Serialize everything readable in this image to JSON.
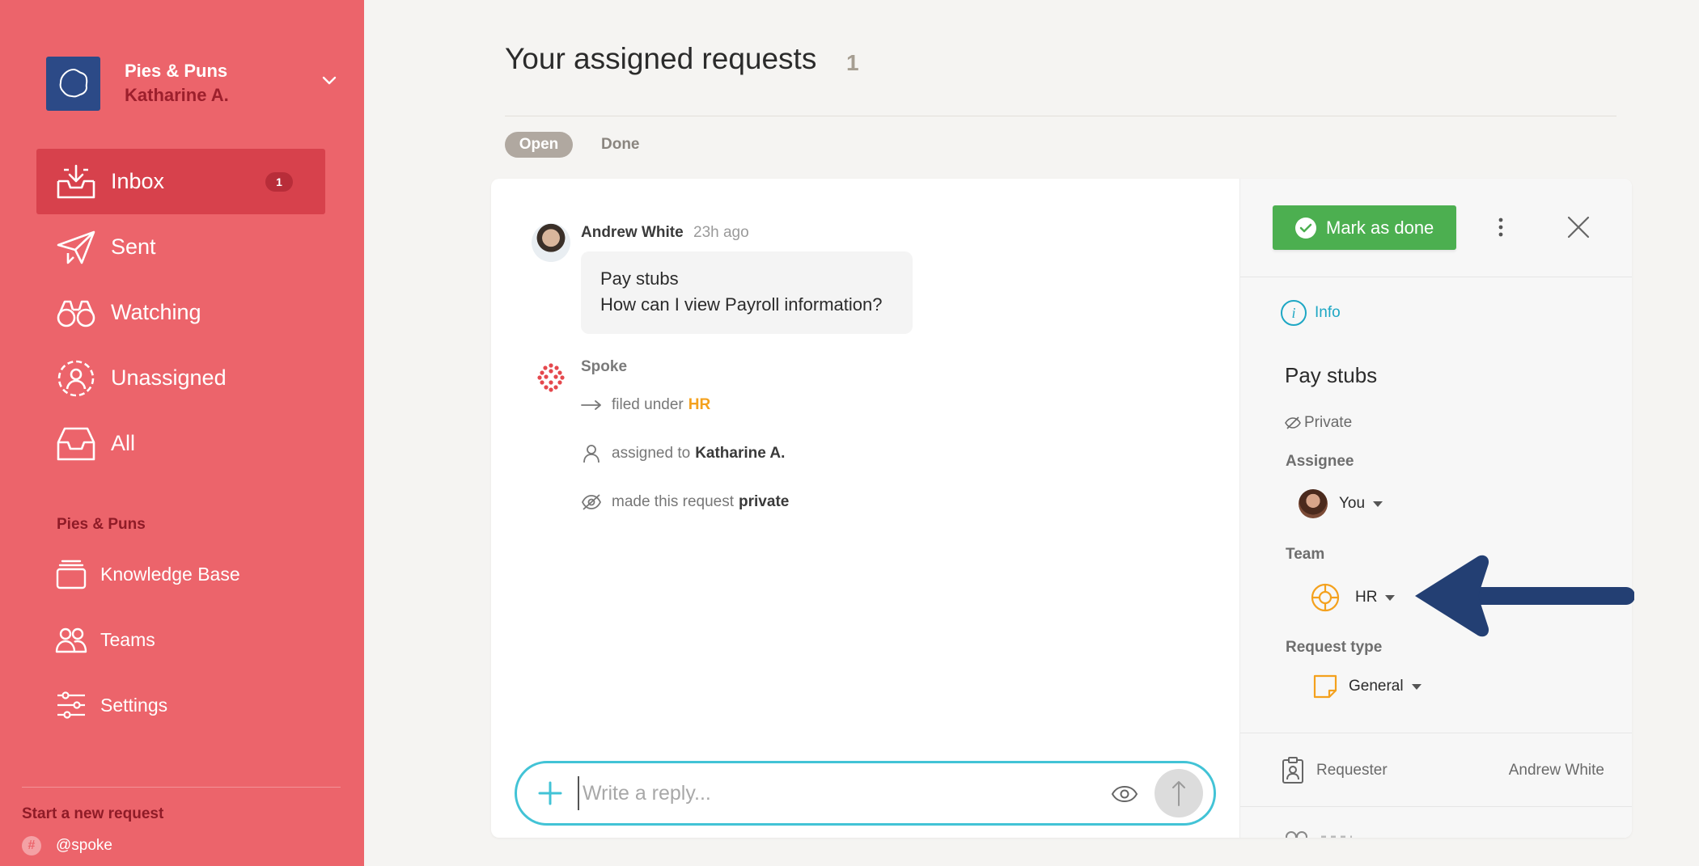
{
  "workspace": {
    "name": "Pies & Puns",
    "user": "Katharine A."
  },
  "nav": {
    "items": [
      {
        "label": "Inbox",
        "badge": "1",
        "icon": "inbox-icon"
      },
      {
        "label": "Sent",
        "icon": "paper-plane-icon"
      },
      {
        "label": "Watching",
        "icon": "binoculars-icon"
      },
      {
        "label": "Unassigned",
        "icon": "unassigned-user-icon"
      },
      {
        "label": "All",
        "icon": "tray-icon"
      }
    ],
    "section_label": "Pies & Puns",
    "section_items": [
      {
        "label": "Knowledge Base",
        "icon": "stack-icon"
      },
      {
        "label": "Teams",
        "icon": "people-icon"
      },
      {
        "label": "Settings",
        "icon": "sliders-icon"
      }
    ],
    "start_request": "Start a new request",
    "slack_handle": "@spoke"
  },
  "header": {
    "title": "Your assigned requests",
    "count": "1",
    "tabs": [
      {
        "label": "Open",
        "active": true
      },
      {
        "label": "Done",
        "active": false
      }
    ]
  },
  "conversation": {
    "message": {
      "author": "Andrew White",
      "time": "23h ago",
      "subject": "Pay stubs",
      "body": "How can I view Payroll information?"
    },
    "system": {
      "name": "Spoke",
      "events": [
        {
          "prefix": "filed under",
          "value": "HR",
          "icon": "arrow-right-icon"
        },
        {
          "prefix": "assigned to",
          "value": "Katharine A.",
          "icon": "user-icon"
        },
        {
          "prefix": "made this request",
          "value": "private",
          "icon": "eye-slash-icon"
        }
      ]
    },
    "reply": {
      "placeholder": "Write a reply..."
    }
  },
  "details": {
    "mark_done_label": "Mark as done",
    "info_tab": "Info",
    "title": "Pay stubs",
    "privacy": "Private",
    "assignee_label": "Assignee",
    "assignee_value": "You",
    "team_label": "Team",
    "team_value": "HR",
    "request_type_label": "Request type",
    "request_type_value": "General",
    "requester_label": "Requester",
    "requester_value": "Andrew White"
  },
  "colors": {
    "sidebar": "#ec646b",
    "sidebar_active": "#d7414c",
    "accent_teal": "#42c3d6",
    "success_green": "#4caf50",
    "hr_orange": "#f4a11d",
    "annotation_arrow": "#233f73"
  }
}
